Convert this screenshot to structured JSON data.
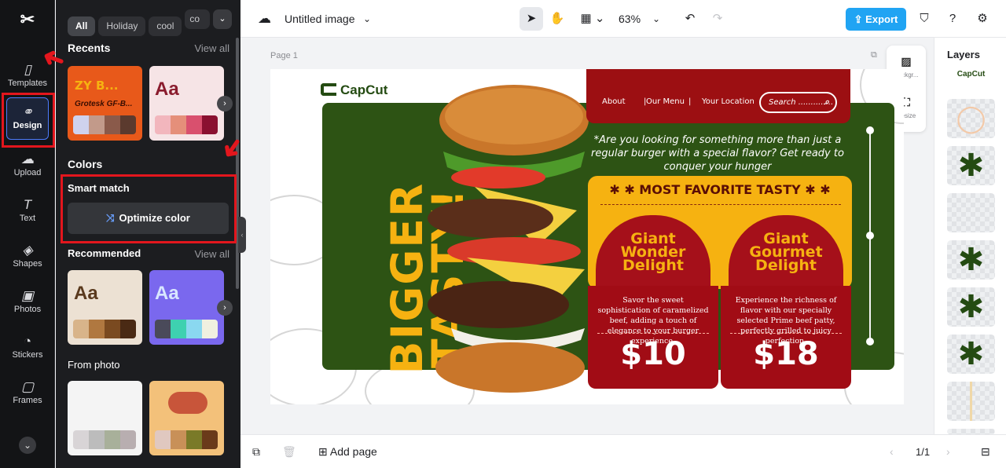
{
  "nav": {
    "logo": "✂",
    "items": [
      {
        "label": "Templates",
        "icon": "templates-icon"
      },
      {
        "label": "Design",
        "icon": "design-icon"
      },
      {
        "label": "Upload",
        "icon": "upload-icon"
      },
      {
        "label": "Text",
        "icon": "text-icon"
      },
      {
        "label": "Shapes",
        "icon": "shapes-icon"
      },
      {
        "label": "Photos",
        "icon": "photos-icon"
      },
      {
        "label": "Stickers",
        "icon": "stickers-icon"
      },
      {
        "label": "Frames",
        "icon": "frames-icon"
      }
    ]
  },
  "panel": {
    "chips": [
      "All",
      "Holiday",
      "cool",
      "co"
    ],
    "recents": {
      "title": "Recents",
      "view_all": "View all",
      "card1_text": "Grotesk GF-B...",
      "card1_head": "ZY B...",
      "card2_text": "Aa"
    },
    "colors": {
      "title": "Colors",
      "smart_match": "Smart match",
      "optimize": "Optimize color"
    },
    "recommended": {
      "title": "Recommended",
      "view_all": "View all",
      "aa": "Aa"
    },
    "from_photo": {
      "title": "From photo"
    }
  },
  "topbar": {
    "doc_title": "Untitled image",
    "zoom": "63%",
    "export": "Export"
  },
  "canvas": {
    "page_label": "Page 1",
    "tools": [
      {
        "label": "Backgr..."
      },
      {
        "label": "Resize"
      }
    ]
  },
  "design": {
    "brand": "CapCut",
    "headline_1": "BIGGER",
    "headline_2": "TASTY!",
    "nav_about": "About",
    "nav_menu": "Our Menu",
    "nav_location": "Your Location",
    "search_placeholder": "Search ..............",
    "tagline": "*Are you looking for something more than just a regular burger with a special flavor? Get ready to conquer your hunger",
    "favorite": "MOST FAVORITE TASTY",
    "item1_name": "Giant Wonder Delight",
    "item1_desc": "Savor the sweet sophistication of caramelized beef, adding a touch of elegance to your burger experience.",
    "item1_price": "$10",
    "item2_name": "Giant Gourmet Delight",
    "item2_desc": "Experience the richness of flavor with our specially selected Prime beef patty, perfectly grilled to juicy perfection.",
    "item2_price": "$18"
  },
  "layers": {
    "title": "Layers",
    "brand_thumb": "CapCut"
  },
  "bottombar": {
    "add_page": "Add page",
    "page_count": "1/1"
  },
  "colors": {
    "accent": "#20a4f3",
    "highlight": "#e3161d",
    "burger_green": "#2d5314",
    "burger_red": "#a10c15",
    "burger_yellow": "#f6b211"
  }
}
